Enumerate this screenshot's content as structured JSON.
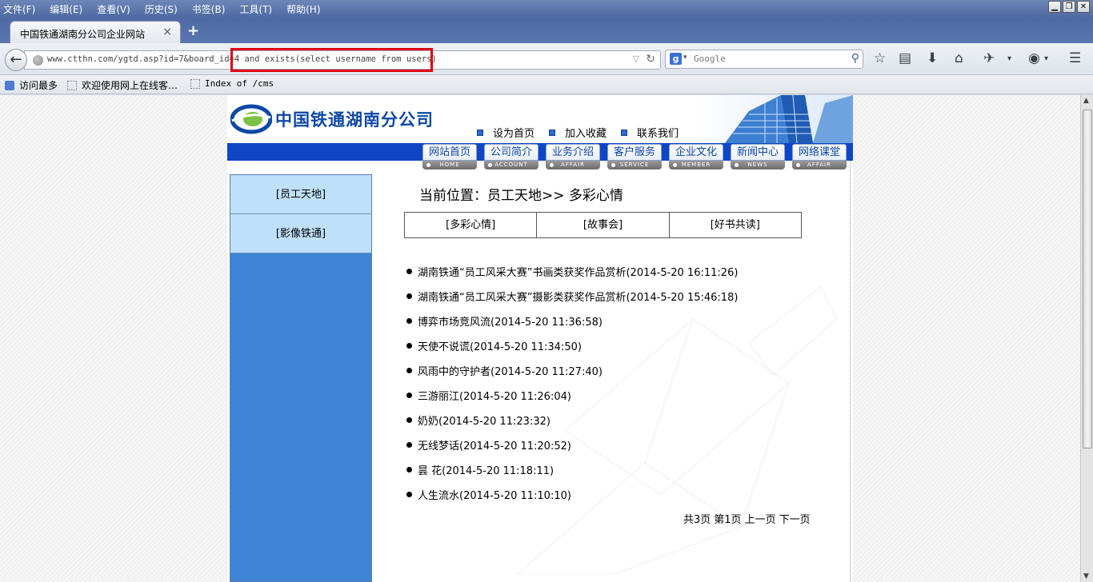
{
  "menubar": {
    "items": [
      "文件(F)",
      "编辑(E)",
      "查看(V)",
      "历史(S)",
      "书签(B)",
      "工具(T)",
      "帮助(H)"
    ]
  },
  "tab": {
    "title": "中国铁通湖南分公司企业网站",
    "close": "×",
    "new_tab": "+"
  },
  "navbar": {
    "url": "www.ctthn.com/ygtd.asp?id=7&board_id=4 and exists(select username from users)",
    "search_placeholder": "Google"
  },
  "bookmarks": [
    {
      "label": "访问最多"
    },
    {
      "label": "欢迎使用网上在线客…"
    },
    {
      "label": "Index of /cms"
    }
  ],
  "site": {
    "logo_text": "中国铁通湖南分公司",
    "top_links": [
      "设为首页",
      "加入收藏",
      "联系我们"
    ],
    "nav": [
      {
        "label": "网站首页",
        "sub": "HOME"
      },
      {
        "label": "公司简介",
        "sub": "ACCOUNT"
      },
      {
        "label": "业务介绍",
        "sub": "AFFAIR"
      },
      {
        "label": "客户服务",
        "sub": "SERVICE"
      },
      {
        "label": "企业文化",
        "sub": "MEMBER"
      },
      {
        "label": "新闻中心",
        "sub": "NEWS"
      },
      {
        "label": "网络课堂",
        "sub": "AFFAIR"
      }
    ],
    "sidebar": [
      "[员工天地]",
      "[影像铁通]"
    ],
    "breadcrumb": "当前位置：员工天地>> 多彩心情",
    "subtabs": [
      "[多彩心情]",
      "[故事会]",
      "[好书共读]"
    ],
    "articles": [
      "湖南铁通“员工风采大赛”书画类获奖作品赏析(2014-5-20 16:11:26)",
      "湖南铁通“员工风采大赛”摄影类获奖作品赏析(2014-5-20 15:46:18)",
      "博弈市场竞风流(2014-5-20 11:36:58)",
      "天使不说谎(2014-5-20 11:34:50)",
      "风雨中的守护者(2014-5-20 11:27:40)",
      "三游丽江(2014-5-20 11:26:04)",
      "奶奶(2014-5-20 11:23:32)",
      "无线梦话(2014-5-20 11:20:52)",
      "昙 花(2014-5-20 11:18:11)",
      "人生流水(2014-5-20 11:10:10)"
    ],
    "pager": {
      "total": "共3页",
      "current": "第1页",
      "prev": "上一页",
      "next": "下一页"
    }
  },
  "colors": {
    "highlight": "#e00010",
    "site_blue": "#0f46c6",
    "sidebar_blue": "#3f85d7",
    "sidebar_item": "#bfe0fb"
  }
}
